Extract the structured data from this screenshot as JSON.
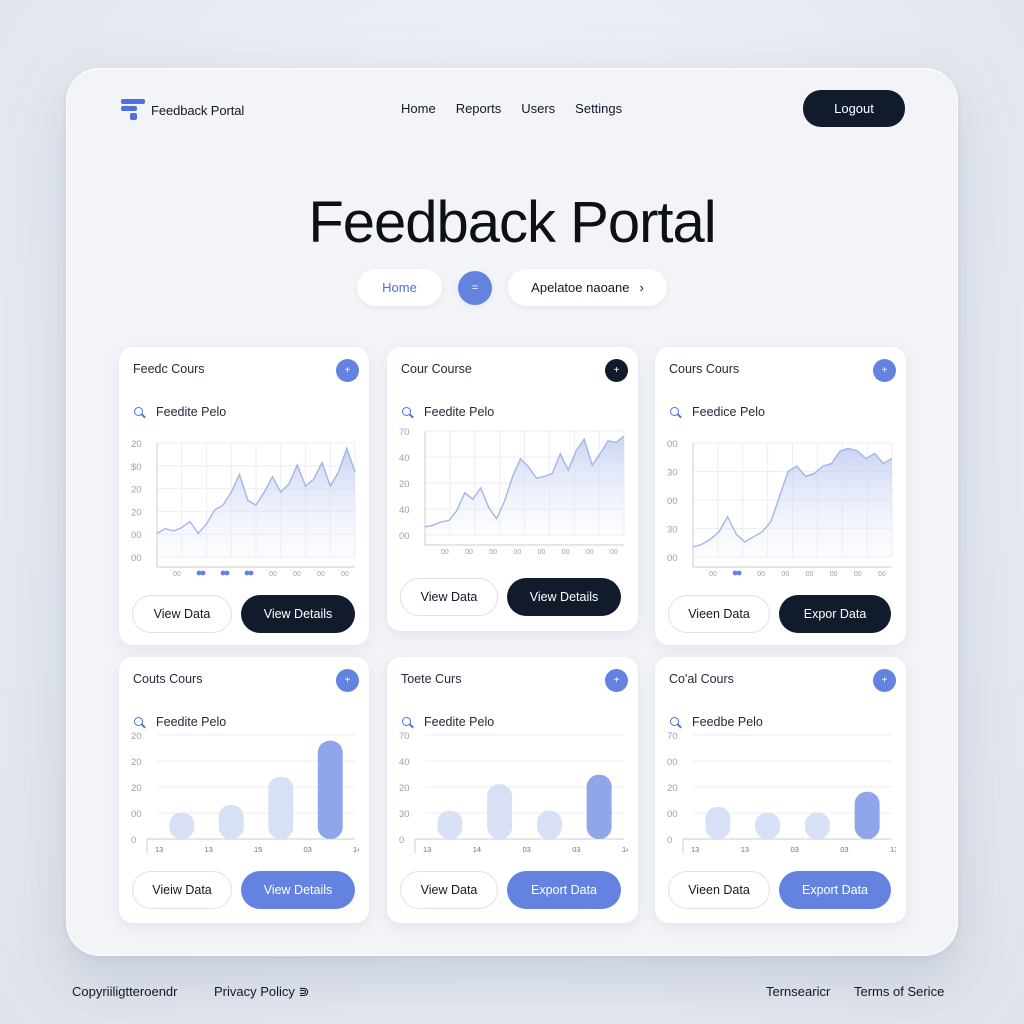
{
  "header": {
    "brand": "Feedback Portal",
    "nav": [
      "Home",
      "Reports",
      "Users",
      "Settings"
    ],
    "logout": "Logout"
  },
  "hero": {
    "title": "Feedback Portal"
  },
  "breadcrumb": {
    "home": "Home",
    "separator": "=",
    "current": "Apelatoe naoane",
    "chevron": "›"
  },
  "colors": {
    "accent": "#6483e0",
    "dark": "#111b2b",
    "chart_line": "#a4b5e6"
  },
  "cards": [
    {
      "title": "Feedc Cours",
      "plus_dark": false,
      "subtitle": "Feedite Pelo",
      "btn1": "View Data",
      "btn2": "View Details",
      "btn2_style": "dark",
      "chart_data": {
        "type": "area",
        "yticks": [
          "20",
          "$0",
          "20",
          "20",
          "00",
          "00"
        ],
        "xticks": [
          "00",
          "00",
          "00",
          "00",
          "00",
          "00",
          "00",
          "00"
        ],
        "dots": [
          1,
          2,
          3
        ],
        "values": [
          20,
          24,
          22,
          25,
          30,
          20,
          28,
          40,
          44,
          55,
          70,
          48,
          44,
          55,
          68,
          55,
          62,
          78,
          60,
          66,
          80,
          60,
          72,
          92,
          72
        ]
      }
    },
    {
      "title": "Cour Course",
      "plus_dark": true,
      "subtitle": "Feedite Pelo",
      "btn1": "View Data",
      "btn2": "View Details",
      "btn2_style": "dark",
      "chart_data": {
        "type": "area",
        "yticks": [
          "70",
          "40",
          "20",
          "40",
          "00"
        ],
        "xticks": [
          "00",
          "00",
          "00",
          "00",
          "00",
          "00",
          "00",
          "00"
        ],
        "dots": [],
        "values": [
          10,
          12,
          16,
          18,
          30,
          52,
          44,
          58,
          34,
          20,
          42,
          72,
          94,
          84,
          70,
          72,
          76,
          100,
          80,
          104,
          118,
          86,
          100,
          116,
          114,
          122
        ]
      }
    },
    {
      "title": "Cours Cours",
      "plus_dark": false,
      "subtitle": "Feedice Pelo",
      "btn1": "Vieen Data",
      "btn2": "Expor Data",
      "btn2_style": "dark",
      "chart_data": {
        "type": "area",
        "yticks": [
          "00",
          "30",
          "00",
          "30",
          "00"
        ],
        "xticks": [
          "00",
          "00",
          "00",
          "00",
          "00",
          "00",
          "00",
          "00"
        ],
        "dots": [
          1
        ],
        "values": [
          8,
          10,
          14,
          20,
          32,
          18,
          12,
          16,
          20,
          28,
          48,
          68,
          72,
          64,
          66,
          72,
          74,
          84,
          86,
          84,
          78,
          82,
          74,
          78
        ]
      }
    },
    {
      "title": "Couts Cours",
      "plus_dark": false,
      "subtitle": "Feedite Pelo",
      "btn1": "Vieiw Data",
      "btn2": "View Details",
      "btn2_style": "blue",
      "chart_data": {
        "type": "bar",
        "yticks": [
          "20",
          "20",
          "20",
          "00",
          "0"
        ],
        "xticks": [
          "13",
          "13",
          "15",
          "03",
          "14"
        ],
        "values": [
          28,
          36,
          66,
          104
        ]
      }
    },
    {
      "title": "Toete Curs",
      "plus_dark": false,
      "subtitle": "Feedite Pelo",
      "btn1": "View Data",
      "btn2": "Export Data",
      "btn2_style": "blue",
      "chart_data": {
        "type": "bar",
        "yticks": [
          "70",
          "40",
          "20",
          "30",
          "0"
        ],
        "xticks": [
          "13",
          "14",
          "03",
          "03",
          "14"
        ],
        "values": [
          30,
          58,
          30,
          68
        ]
      }
    },
    {
      "title": "Co'al Cours",
      "plus_dark": false,
      "subtitle": "Feedbe Pelo",
      "btn1": "Vieen Data",
      "btn2": "Export Data",
      "btn2_style": "blue",
      "chart_data": {
        "type": "bar",
        "yticks": [
          "70",
          "00",
          "20",
          "00",
          "0"
        ],
        "xticks": [
          "13",
          "13",
          "03",
          "03",
          "13"
        ],
        "values": [
          34,
          28,
          28,
          50
        ]
      }
    }
  ],
  "footer": {
    "copyright": "Copyriiligtteroendr",
    "privacy": "Privacy Policy",
    "privacy_chevron": "⋑",
    "terms_short": "Ternsearicr",
    "terms": "Terms of Serice"
  }
}
